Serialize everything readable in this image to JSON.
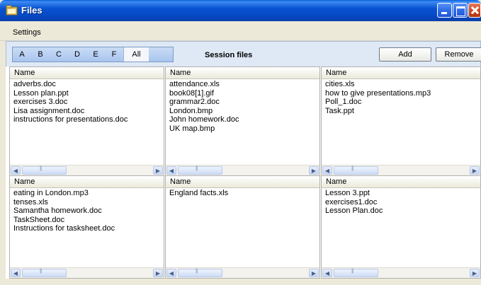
{
  "window": {
    "title": "Files"
  },
  "menu": {
    "items": [
      {
        "label": "Settings"
      }
    ]
  },
  "toolbar": {
    "letter_tabs": [
      "A",
      "B",
      "C",
      "D",
      "E",
      "F",
      "All"
    ],
    "selected_tab": "All",
    "session_title": "Session files",
    "add_label": "Add",
    "remove_label": "Remove"
  },
  "panes": [
    {
      "header": "Name",
      "files": [
        "adverbs.doc",
        "Lesson plan.ppt",
        "exercises 3.doc",
        "Lisa assignment.doc",
        "instructions for presentations.doc"
      ]
    },
    {
      "header": "Name",
      "files": [
        "attendance.xls",
        "book08[1].gif",
        "grammar2.doc",
        "London.bmp",
        "John homework.doc",
        "UK map.bmp"
      ]
    },
    {
      "header": "Name",
      "files": [
        "cities.xls",
        "how to give presentations.mp3",
        "Poll_1.doc",
        "Task.ppt"
      ]
    },
    {
      "header": "Name",
      "files": [
        "eating in London.mp3",
        "tenses.xls",
        "Samantha homework.doc",
        "TaskSheet.doc",
        "Instructions for tasksheet.doc"
      ]
    },
    {
      "header": "Name",
      "files": [
        "England facts.xls"
      ]
    },
    {
      "header": "Name",
      "files": [
        "Lesson 3.ppt",
        "exercises1.doc",
        "Lesson Plan.doc"
      ]
    }
  ],
  "colors": {
    "titlebar": "#0a52d0",
    "toolbar_bg": "#dfe9f5",
    "window_bg": "#ece9d8"
  },
  "icons": [
    "folder-icon",
    "minimize-icon",
    "maximize-icon",
    "close-icon",
    "scroll-left-icon",
    "scroll-right-icon"
  ]
}
